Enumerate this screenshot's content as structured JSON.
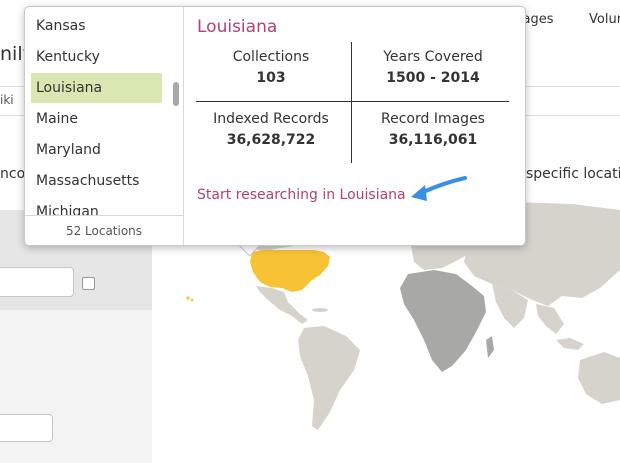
{
  "topnav": {
    "messages_label": "ssages",
    "volunteer_label": "Volur"
  },
  "page": {
    "heading_partial": "nily",
    "tab_partial": "iki",
    "intro_left_partial": "ncov",
    "intro_right_partial": "specific locati"
  },
  "popover": {
    "states": [
      {
        "label": "Kansas",
        "selected": false
      },
      {
        "label": "Kentucky",
        "selected": false
      },
      {
        "label": "Louisiana",
        "selected": true
      },
      {
        "label": "Maine",
        "selected": false
      },
      {
        "label": "Maryland",
        "selected": false
      },
      {
        "label": "Massachusetts",
        "selected": false
      },
      {
        "label": "Michigan",
        "selected": false
      }
    ],
    "location_count": "52 Locations",
    "selected_title": "Louisiana",
    "stats": {
      "collections_label": "Collections",
      "collections_value": "103",
      "years_label": "Years Covered",
      "years_value": "1500 - 2014",
      "indexed_label": "Indexed Records",
      "indexed_value": "36,628,722",
      "images_label": "Record Images",
      "images_value": "36,116,061"
    },
    "research_link": "Start researching in Louisiana"
  },
  "colors": {
    "accent": "#b2407a",
    "selected_row": "#d9e8b2",
    "highlight_country": "#f7c334",
    "map_land": "#d6d3cc",
    "map_africa": "#a8a8a6",
    "annotation_arrow": "#3a8ee6"
  }
}
